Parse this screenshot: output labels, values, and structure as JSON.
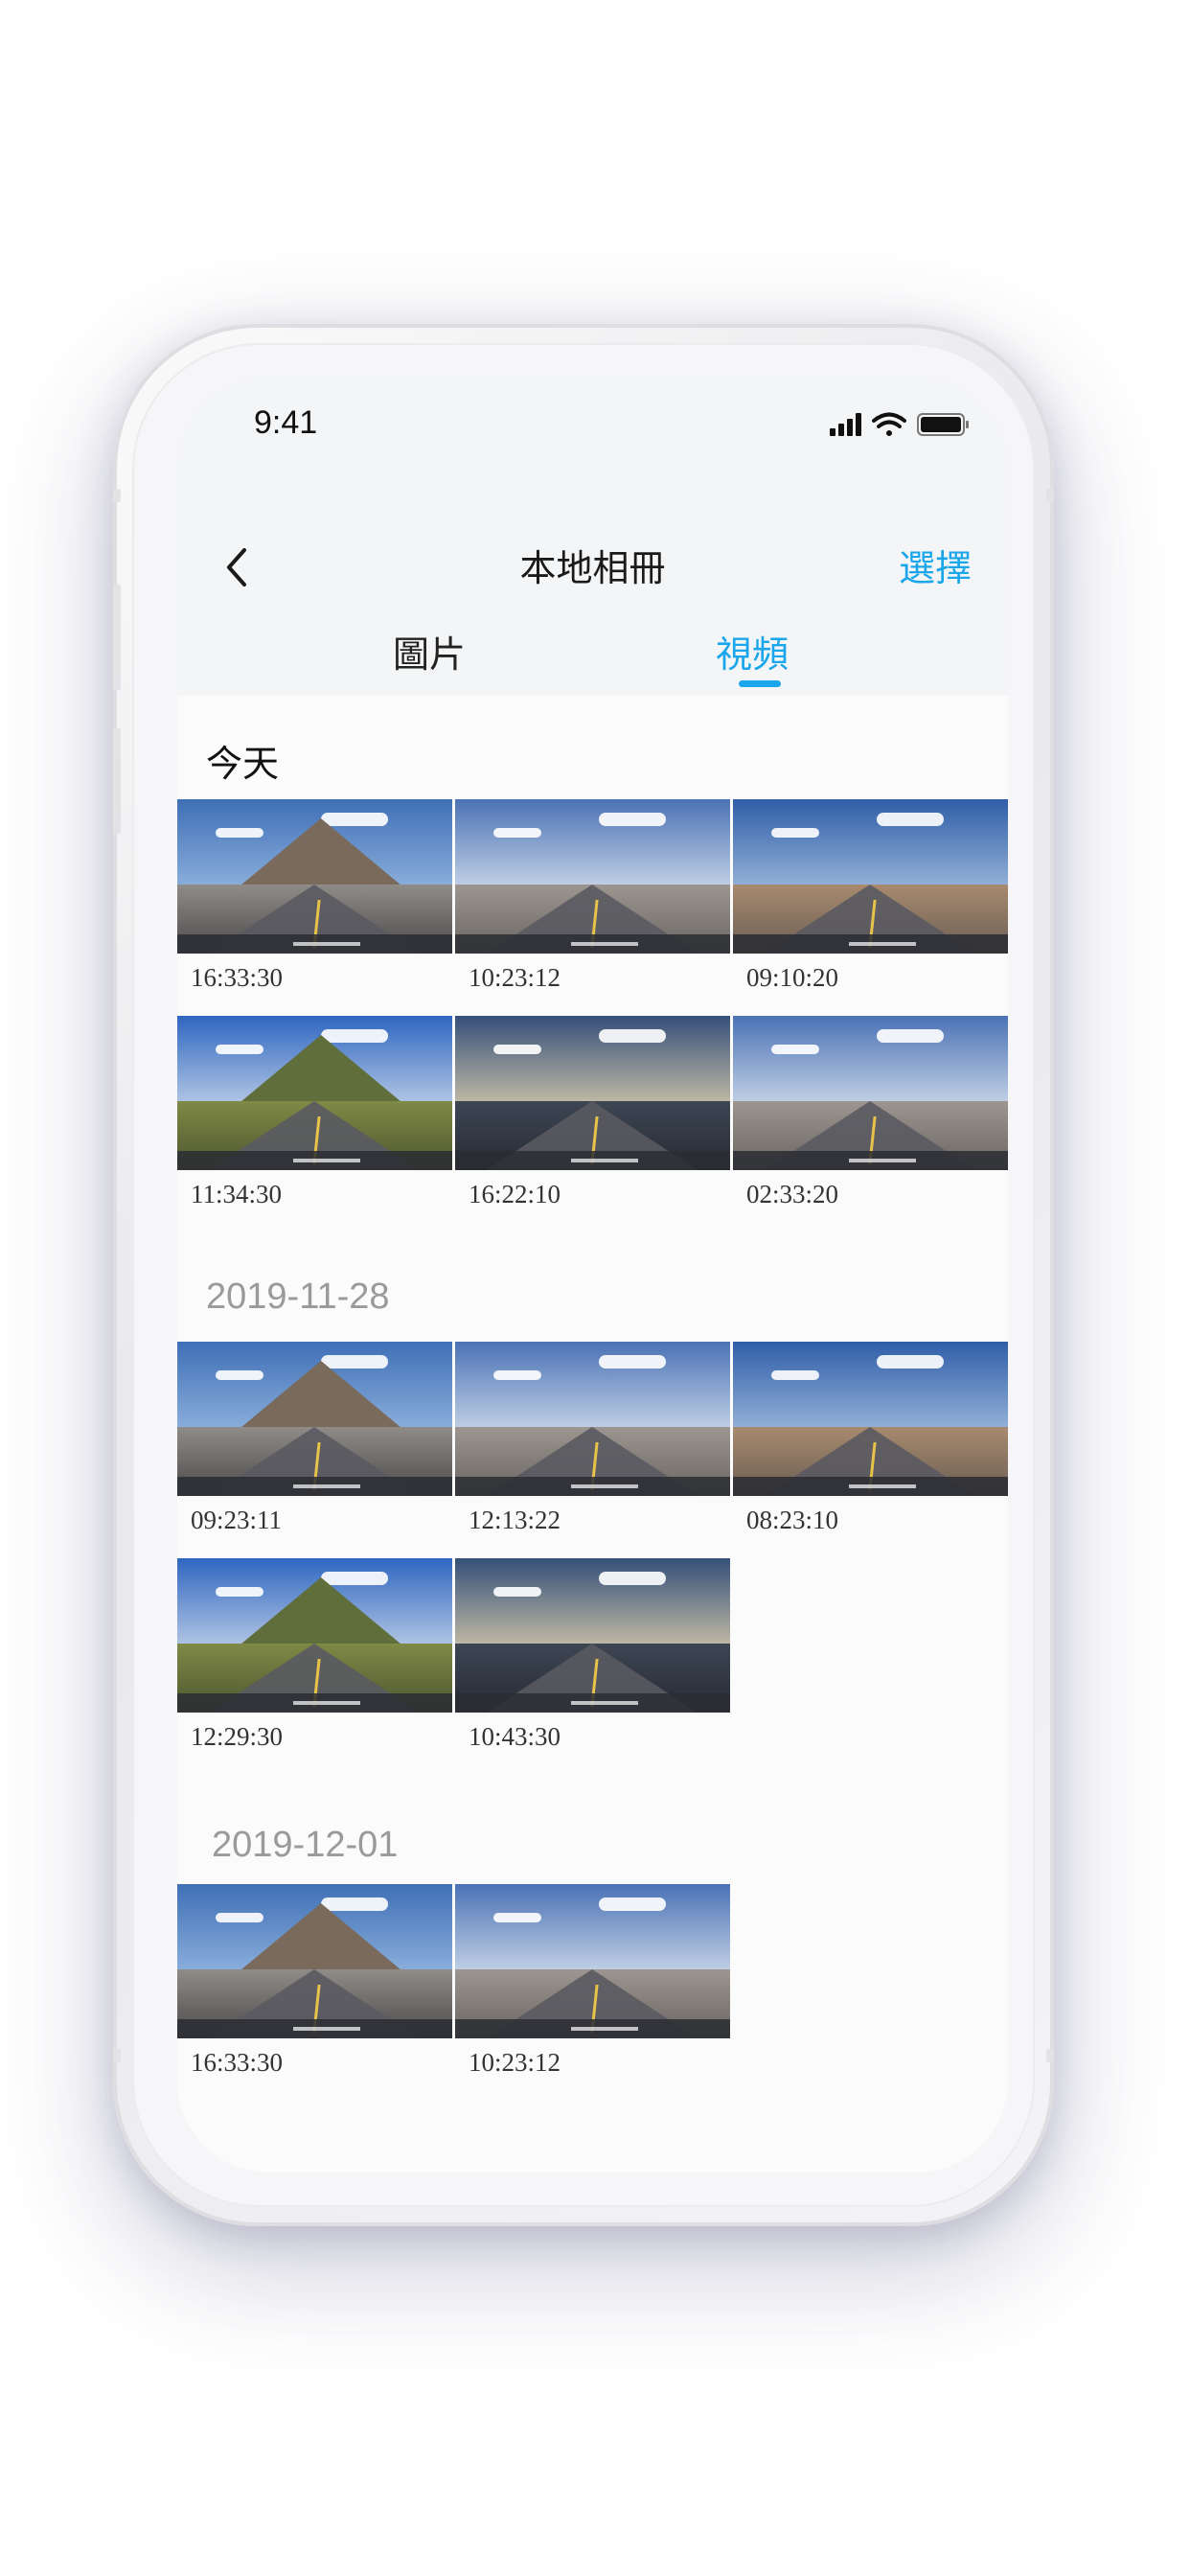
{
  "status_bar": {
    "time": "9:41",
    "signal_icon": "signal-bars-icon",
    "wifi_icon": "wifi-icon",
    "battery_icon": "battery-icon"
  },
  "nav": {
    "title": "本地相冊",
    "back_icon": "chevron-left-icon",
    "select_label": "選擇"
  },
  "tabs": [
    {
      "label": "圖片",
      "active": false
    },
    {
      "label": "視頻",
      "active": true
    }
  ],
  "accent_color": "#1aa6ea",
  "sections": [
    {
      "title": "今天",
      "items": [
        {
          "time": "16:33:30",
          "scene": "mountain"
        },
        {
          "time": "10:23:12",
          "scene": "sun"
        },
        {
          "time": "09:10:20",
          "scene": "desert"
        },
        {
          "time": "11:34:30",
          "scene": "hills"
        },
        {
          "time": "16:22:10",
          "scene": "sunset"
        },
        {
          "time": "02:33:20",
          "scene": "sun"
        }
      ]
    },
    {
      "title": "2019-11-28",
      "items": [
        {
          "time": "09:23:11",
          "scene": "mountain"
        },
        {
          "time": "12:13:22",
          "scene": "sun"
        },
        {
          "time": "08:23:10",
          "scene": "desert"
        },
        {
          "time": "12:29:30",
          "scene": "hills"
        },
        {
          "time": "10:43:30",
          "scene": "sunset"
        }
      ]
    },
    {
      "title": "2019-12-01",
      "items": [
        {
          "time": "16:33:30",
          "scene": "mountain"
        },
        {
          "time": "10:23:12",
          "scene": "sun"
        }
      ]
    }
  ]
}
